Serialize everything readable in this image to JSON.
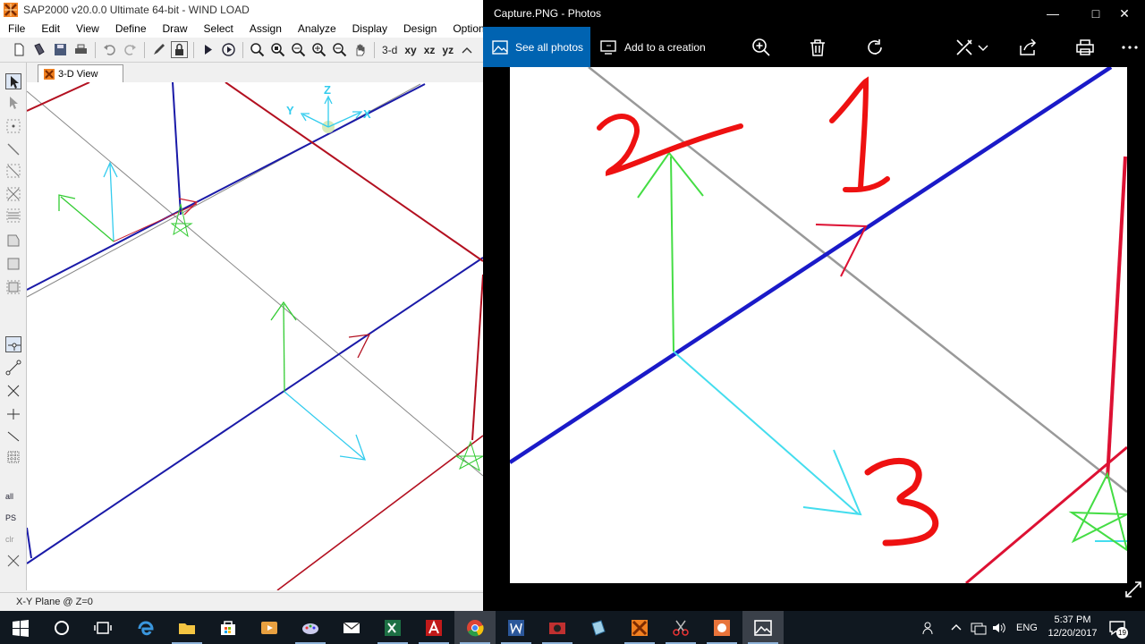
{
  "sap": {
    "title": "SAP2000 v20.0.0 Ultimate 64-bit - WIND LOAD",
    "menu": [
      "File",
      "Edit",
      "View",
      "Define",
      "Draw",
      "Select",
      "Assign",
      "Analyze",
      "Display",
      "Design",
      "Options"
    ],
    "toolbar_text": {
      "view3d": "3-d",
      "xy": "xy",
      "xz": "xz",
      "yz": "yz"
    },
    "tab": "3-D View",
    "axis_labels": {
      "z": "Z",
      "y": "Y",
      "x": "X"
    },
    "status": "X-Y Plane @ Z=0",
    "side_labels": {
      "all": "all",
      "ps": "PS",
      "clr": "clr"
    }
  },
  "photos": {
    "title": "Capture.PNG - Photos",
    "see_all": "See all photos",
    "add_creation": "Add to a creation",
    "icons": [
      "zoom-in-icon",
      "delete-icon",
      "rotate-icon",
      "edit-icon",
      "share-icon",
      "print-icon",
      "more-icon"
    ],
    "annotations": {
      "one": "1",
      "two": "2",
      "three": "3"
    }
  },
  "taskbar": {
    "apps": [
      "start-icon",
      "cortana-icon",
      "task-view-icon",
      "edge-icon",
      "file-explorer-icon",
      "store-icon",
      "media-icon",
      "paint-icon",
      "mail-icon",
      "excel-icon",
      "autocad-icon",
      "chrome-icon",
      "word-icon",
      "video-icon",
      "sketchup-icon",
      "sap2000-icon",
      "snip-icon",
      "etabs-icon",
      "photos-icon"
    ],
    "lang": "ENG",
    "time": "5:37 PM",
    "date": "12/20/2017",
    "notifications": "19"
  },
  "colors": {
    "sap_accent": "#0063b1",
    "beam_blue": "#1a1aa8",
    "beam_red": "#b31020",
    "axis_green": "#33cc33",
    "axis_cyan": "#33ccee",
    "annotation_red": "#ee1111"
  }
}
